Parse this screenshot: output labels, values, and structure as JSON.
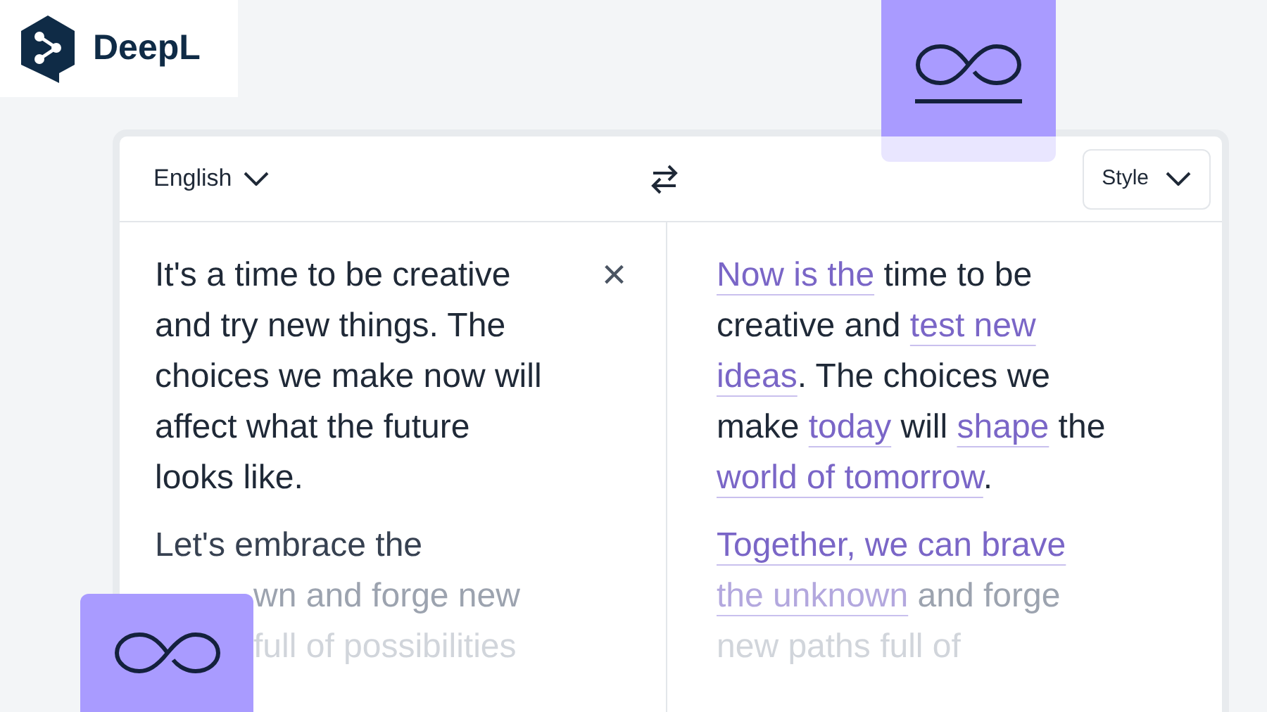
{
  "logo": {
    "name": "DeepL"
  },
  "toolbar": {
    "source_language": "English",
    "style_button": "Style"
  },
  "source": {
    "clear_icon": "×",
    "paragraphs": [
      [
        [
          {
            "text": "It's a time to be creative",
            "highlighted": false
          }
        ],
        [
          {
            "text": "and try new things. The",
            "highlighted": false
          }
        ],
        [
          {
            "text": "choices we make now will",
            "highlighted": false
          }
        ],
        [
          {
            "text": "affect what the future",
            "highlighted": false
          }
        ],
        [
          {
            "text": "looks like.",
            "highlighted": false
          }
        ]
      ],
      [
        [
          {
            "text": "Let's embrace the",
            "highlighted": false
          }
        ],
        [
          {
            "text": "wn and forge new",
            "highlighted": false,
            "covered_start": true
          }
        ],
        [
          {
            "text": "full of possibilities",
            "highlighted": false,
            "covered_start": true
          }
        ]
      ]
    ]
  },
  "target": {
    "paragraphs": [
      [
        [
          {
            "text": "Now is the",
            "highlighted": true
          },
          {
            "text": " time to be",
            "highlighted": false
          }
        ],
        [
          {
            "text": "creative and ",
            "highlighted": false
          },
          {
            "text": "test new",
            "highlighted": true
          }
        ],
        [
          {
            "text": "ideas",
            "highlighted": true
          },
          {
            "text": ". The choices we",
            "highlighted": false
          }
        ],
        [
          {
            "text": "make ",
            "highlighted": false
          },
          {
            "text": "today",
            "highlighted": true
          },
          {
            "text": " will ",
            "highlighted": false
          },
          {
            "text": "shape",
            "highlighted": true
          },
          {
            "text": " the",
            "highlighted": false
          }
        ],
        [
          {
            "text": "world of tomorrow",
            "highlighted": true
          },
          {
            "text": ".",
            "highlighted": false
          }
        ]
      ],
      [
        [
          {
            "text": "Together, we can brave",
            "highlighted": true
          }
        ],
        [
          {
            "text": "the unknown",
            "highlighted": true
          },
          {
            "text": " and forge",
            "highlighted": false
          }
        ],
        [
          {
            "text": "new paths full of",
            "highlighted": false
          }
        ]
      ]
    ]
  }
}
